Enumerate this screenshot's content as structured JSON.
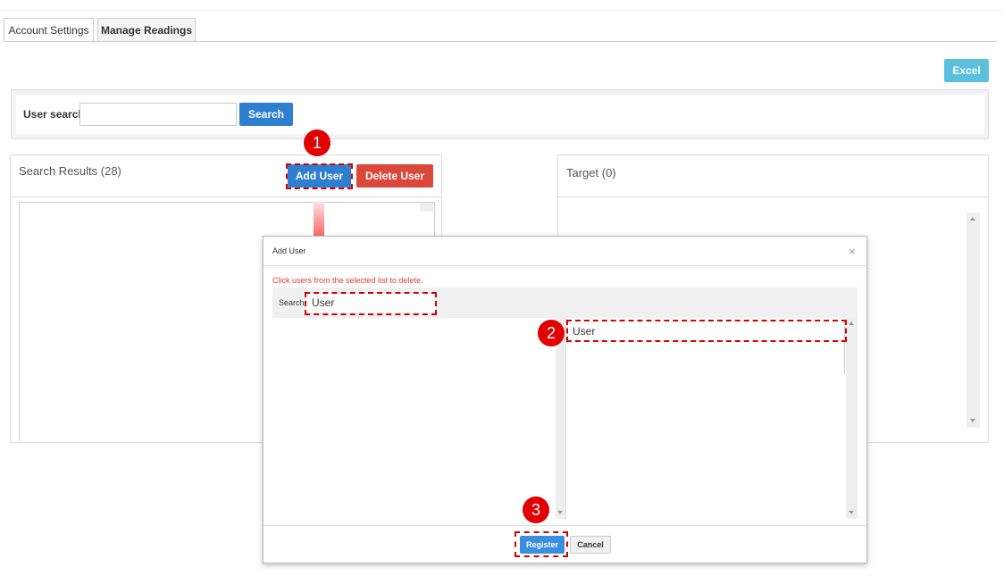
{
  "tabs": [
    {
      "label": "Account Settings"
    },
    {
      "label": "Manage Readings"
    }
  ],
  "toolbar": {
    "excel_label": "Excel"
  },
  "search": {
    "label": "User search",
    "value": "",
    "button_label": "Search"
  },
  "results_panel": {
    "title": "Search Results (28)",
    "add_button": "Add User",
    "delete_button": "Delete User"
  },
  "target_panel": {
    "title": "Target (0)"
  },
  "modal": {
    "title": "Add User",
    "close_glyph": "×",
    "instruction": "Click users from the selected list to delete.",
    "search_label": "Search",
    "search_value": "User",
    "selected_items": [
      "User"
    ],
    "register_label": "Register",
    "cancel_label": "Cancel"
  },
  "steps": [
    "1",
    "2",
    "3"
  ],
  "colors": {
    "primary": "#2f7fd0",
    "danger": "#d9483b",
    "info": "#5bc0de",
    "highlight": "#d40000",
    "badge": "#e00000"
  }
}
